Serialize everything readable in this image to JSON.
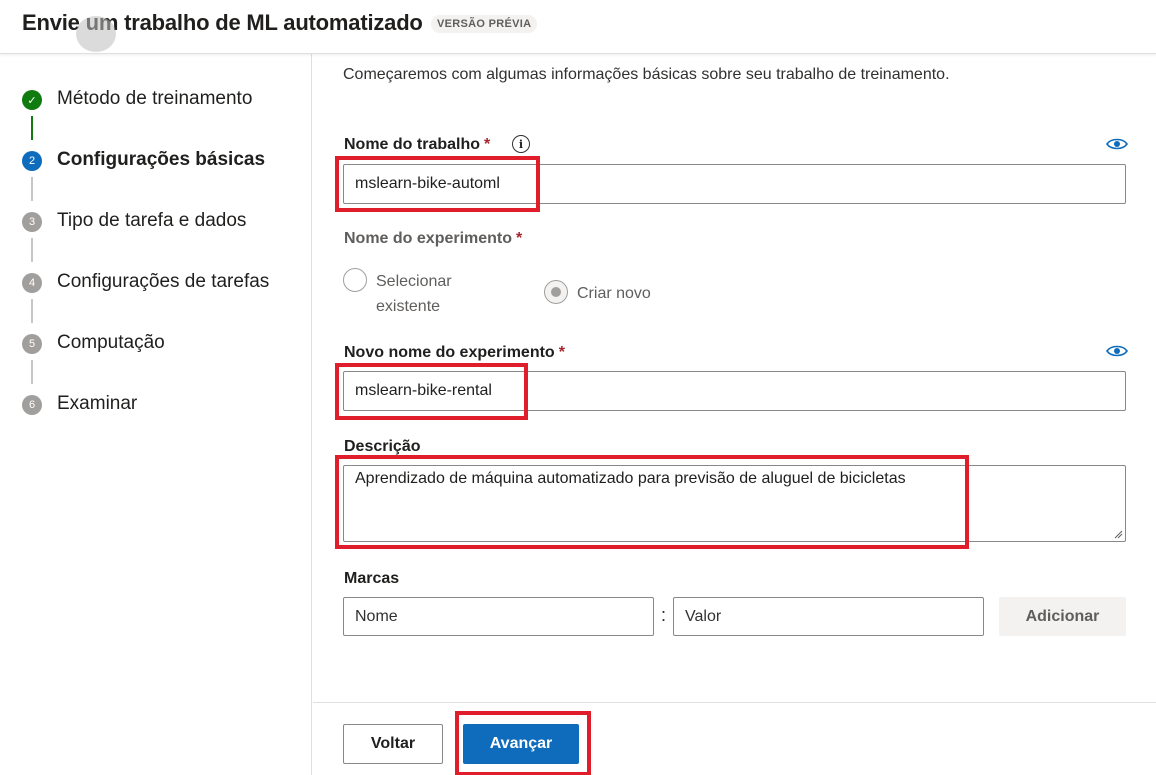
{
  "header": {
    "title": "Envie um trabalho de ML automatizado",
    "badge": "VERSÃO PRÉVIA"
  },
  "stepper": {
    "steps": [
      {
        "number": "✓",
        "label": "Método de treinamento",
        "state": "done"
      },
      {
        "number": "2",
        "label": "Configurações básicas",
        "state": "active"
      },
      {
        "number": "3",
        "label": "Tipo de tarefa e dados",
        "state": "pending"
      },
      {
        "number": "4",
        "label": "Configurações de tarefas",
        "state": "pending"
      },
      {
        "number": "5",
        "label": "Computação",
        "state": "pending"
      },
      {
        "number": "6",
        "label": "Examinar",
        "state": "pending"
      }
    ]
  },
  "form": {
    "intro": "Começaremos com algumas informações básicas sobre seu trabalho de treinamento.",
    "job_name": {
      "label": "Nome do trabalho",
      "required": "*",
      "value": "mslearn-bike-automl"
    },
    "experiment": {
      "label": "Nome do experimento",
      "required": "*",
      "option_existing": "Selecionar existente",
      "option_existing_line1": "Selecionar",
      "option_existing_line2": "existente",
      "option_new": "Criar novo",
      "selected": "Criar novo"
    },
    "new_experiment": {
      "label": "Novo nome do experimento",
      "required": "*",
      "value": "mslearn-bike-rental"
    },
    "description": {
      "label": "Descrição",
      "value": "Aprendizado de máquina automatizado para previsão de aluguel de bicicletas"
    },
    "tags": {
      "label": "Marcas",
      "name_placeholder": "Nome",
      "separator": ":",
      "value_placeholder": "Valor",
      "add_label": "Adicionar"
    }
  },
  "footer": {
    "back_label": "Voltar",
    "next_label": "Avançar"
  },
  "colors": {
    "accent": "#0f6cbd",
    "success": "#107c10",
    "highlight": "#e01e2b"
  }
}
